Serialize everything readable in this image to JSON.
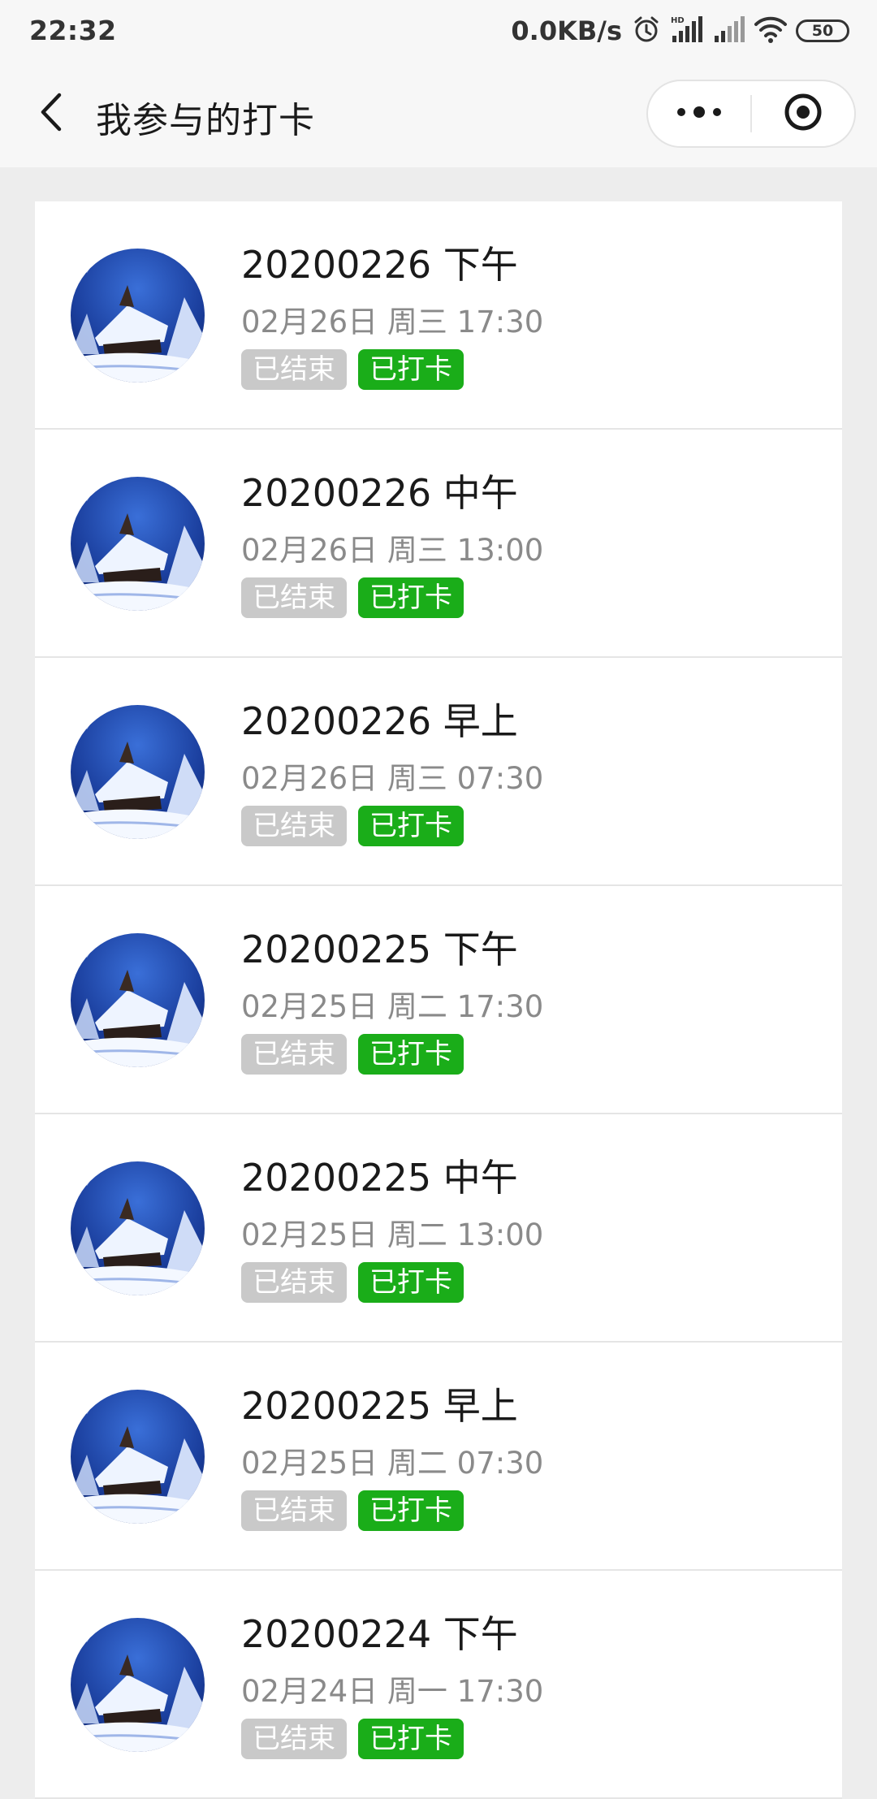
{
  "status_bar": {
    "time": "22:32",
    "network_speed": "0.0KB/s",
    "battery": "50",
    "icons": [
      "alarm-icon",
      "signal-hd-icon",
      "signal-icon",
      "wifi-icon",
      "battery-icon"
    ]
  },
  "nav": {
    "title": "我参与的打卡",
    "back_icon": "chevron-left-icon",
    "more_icon": "more-dots-icon",
    "close_icon": "target-circle-icon"
  },
  "colors": {
    "ended_tag": "#c9c9c9",
    "checked_tag": "#1aad19"
  },
  "items": [
    {
      "title": "20200226 下午",
      "time": "02月26日 周三 17:30",
      "tag_ended": "已结束",
      "tag_checked": "已打卡"
    },
    {
      "title": "20200226 中午",
      "time": "02月26日 周三 13:00",
      "tag_ended": "已结束",
      "tag_checked": "已打卡"
    },
    {
      "title": "20200226 早上",
      "time": "02月26日 周三 07:30",
      "tag_ended": "已结束",
      "tag_checked": "已打卡"
    },
    {
      "title": "20200225 下午",
      "time": "02月25日 周二 17:30",
      "tag_ended": "已结束",
      "tag_checked": "已打卡"
    },
    {
      "title": "20200225 中午",
      "time": "02月25日 周二 13:00",
      "tag_ended": "已结束",
      "tag_checked": "已打卡"
    },
    {
      "title": "20200225 早上",
      "time": "02月25日 周二 07:30",
      "tag_ended": "已结束",
      "tag_checked": "已打卡"
    },
    {
      "title": "20200224 下午",
      "time": "02月24日 周一 17:30",
      "tag_ended": "已结束",
      "tag_checked": "已打卡"
    }
  ]
}
